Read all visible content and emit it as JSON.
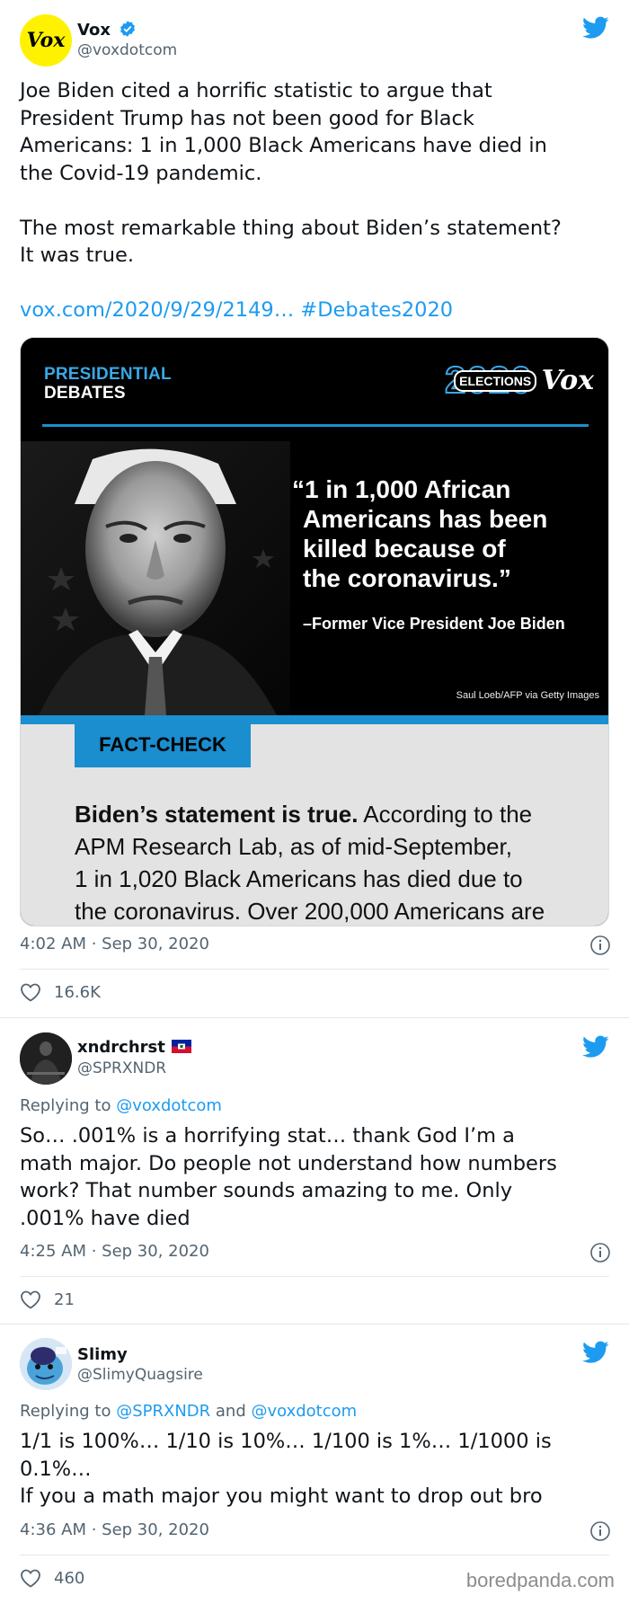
{
  "tweets": [
    {
      "name": "Vox",
      "handle": "@voxdotcom",
      "avatar_text": "Vox",
      "body_lines": [
        "Joe Biden cited a horrific statistic to argue that",
        "President Trump has not been good for Black",
        "Americans: 1 in 1,000 Black Americans have died in",
        "the Covid-19 pandemic.",
        "",
        "The most remarkable thing about Biden’s statement?",
        "It was true.",
        "",
        "vox.com/2020/9/29/2149… #Debates2020"
      ],
      "timestamp": "4:02 AM · Sep 30, 2020",
      "likes": "16.6K",
      "card": {
        "presidential": "PRESIDENTIAL",
        "debates": "DEBATES",
        "year": "2020",
        "elections": "ELECTIONS",
        "brand": "Vox",
        "quote_lines": [
          "“1 in 1,000 African",
          "Americans has been",
          "killed because of",
          "the coronavirus.”"
        ],
        "attribution": "–Former Vice President Joe Biden",
        "credit": "Saul Loeb/AFP via Getty Images",
        "fact_check": "FACT-CHECK",
        "fact_bold": "Biden’s statement is true.",
        "fact_line1_rest": " According to the",
        "fact_lines": [
          "APM Research Lab, as of mid-September,",
          "1 in 1,020 Black Americans has died due to",
          "the coronavirus. Over 200,000 Americans are"
        ]
      }
    },
    {
      "name": "xndrchrst",
      "handle": "@SPRXNDR",
      "replying_prefix": "Replying to ",
      "replying_to": "@voxdotcom",
      "body_lines": [
        "So… .001% is a horrifying stat… thank God I’m a",
        "math major. Do people not understand how numbers",
        "work? That number sounds amazing to me. Only",
        ".001% have died"
      ],
      "timestamp": "4:25 AM · Sep 30, 2020",
      "likes": "21"
    },
    {
      "name": "Slimy",
      "handle": "@SlimyQuagsire",
      "replying_prefix": "Replying to ",
      "replying_to_1": "@SPRXNDR",
      "replying_and": " and ",
      "replying_to_2": "@voxdotcom",
      "body_lines": [
        "1/1 is 100%… 1/10 is 10%… 1/100 is 1%… 1/1000 is",
        "0.1%…",
        "If you a math major you might want to drop out bro"
      ],
      "timestamp": "4:36 AM · Sep 30, 2020",
      "likes": "460"
    }
  ],
  "watermark": "boredpanda.com",
  "colors": {
    "twitter_blue": "#1d9bf0",
    "vox_yellow": "#fff200",
    "verified": "#1d9bf0"
  }
}
